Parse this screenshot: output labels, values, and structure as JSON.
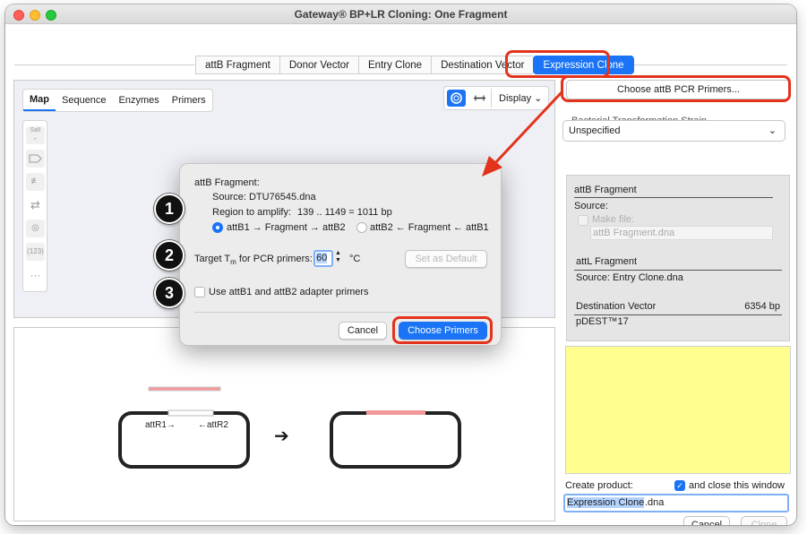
{
  "window": {
    "title": "Gateway® BP+LR Cloning: One Fragment",
    "traffic_lights": [
      "#ff5f57",
      "#febc2e",
      "#28c840"
    ]
  },
  "tabs": [
    "attB Fragment",
    "Donor Vector",
    "Entry Clone",
    "Destination Vector",
    "Expression Clone"
  ],
  "active_tab": "Expression Clone",
  "view_tabs": [
    "Map",
    "Sequence",
    "Enzymes",
    "Primers"
  ],
  "active_view_tab": "Map",
  "display_label": "Display",
  "tool_icons": [
    "restriction-site-tool-icon",
    "feature-tool-icon",
    "primer-tool-icon",
    "orientation-tool-icon",
    "target-tool-icon",
    "numbering-tool-icon",
    "more-tools-icon"
  ],
  "tools": {
    "sall_label": "SalI",
    "numbering_label": "(123)",
    "more_label": "···"
  },
  "right": {
    "choose_primers_button": "Choose attB PCR Primers...",
    "strain_label": "Bacterial Transformation Strain",
    "strain_value": "Unspecified",
    "attb_fragment_heading": "attB Fragment",
    "source_label": "Source:",
    "make_file_label": "Make file:",
    "make_file_value": "attB Fragment.dna",
    "attl_fragment_heading": "attL Fragment",
    "attl_source": "Source:  Entry Clone.dna",
    "destination_heading": "Destination Vector",
    "destination_size": "6354 bp",
    "destination_name": "pDEST™17",
    "create_product_label": "Create product:",
    "close_window_label": "and close this window",
    "close_window_checked": true,
    "product_name_selected": "Expression Clone",
    "product_name_ext": ".dna",
    "cancel_button": "Cancel",
    "clone_button": "Clone"
  },
  "dialog": {
    "heading": "attB Fragment:",
    "source": "Source:  DTU76545.dna",
    "region_label": "Region to amplify:",
    "region_value": "139 .. 1149  =  1011 bp",
    "radio_options": [
      "attB1 → Fragment → attB2",
      "attB2 ← Fragment ← attB1"
    ],
    "selected_radio": 0,
    "tm_label_prefix": "Target T",
    "tm_subscript": "m",
    "tm_label_suffix": " for PCR primers:",
    "tm_value": "60",
    "tm_unit": "°C",
    "set_default_button": "Set as Default",
    "adapter_label": "Use attB1 and attB2 adapter primers",
    "adapter_checked": false,
    "cancel_button": "Cancel",
    "choose_button": "Choose Primers"
  },
  "badges": [
    "1",
    "2",
    "3"
  ],
  "diagram": {
    "left_site": "attR1→",
    "right_site": "←attR2",
    "arrow": "➔"
  },
  "colors": {
    "accent": "#1b74f5",
    "callout": "#e3331c",
    "insert": "#f4999b",
    "product_box": "#ffff8f"
  }
}
